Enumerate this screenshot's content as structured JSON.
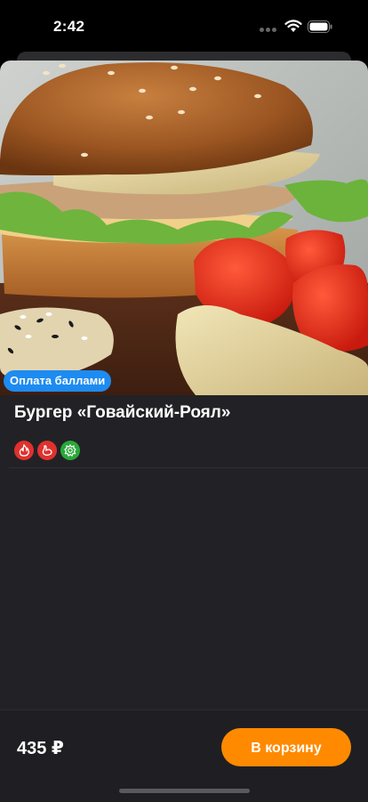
{
  "status_bar": {
    "time": "2:42"
  },
  "product": {
    "badge": "Оплата баллами",
    "title": "Бургер «Говайский-Роял»",
    "tags": [
      {
        "icon": "spicy-icon",
        "color": "#e0312d"
      },
      {
        "icon": "chicken-icon",
        "color": "#e0312d"
      },
      {
        "icon": "vegetable-icon",
        "color": "#2aa83a"
      }
    ]
  },
  "footer": {
    "price": "435 ₽",
    "cart_label": "В корзину"
  },
  "colors": {
    "accent": "#ff8a00",
    "badge": "#1d8bf1",
    "background": "#222226"
  }
}
